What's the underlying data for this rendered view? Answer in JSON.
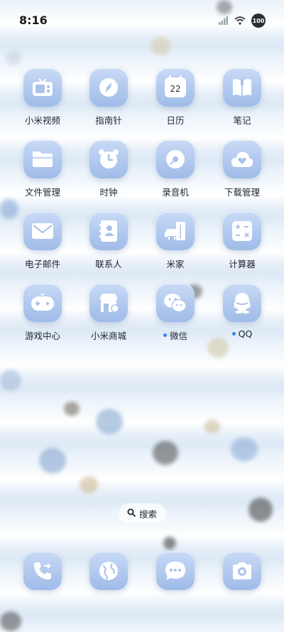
{
  "status_bar": {
    "time": "8:16",
    "battery": "100"
  },
  "apps": [
    {
      "id": "mi-video",
      "label": "小米视频",
      "icon": "tv-icon"
    },
    {
      "id": "compass",
      "label": "指南针",
      "icon": "compass-icon"
    },
    {
      "id": "calendar",
      "label": "日历",
      "icon": "calendar-icon",
      "day": "22"
    },
    {
      "id": "notes",
      "label": "笔记",
      "icon": "notebook-icon"
    },
    {
      "id": "file-manager",
      "label": "文件管理",
      "icon": "folder-icon"
    },
    {
      "id": "clock",
      "label": "时钟",
      "icon": "alarm-clock-icon"
    },
    {
      "id": "recorder",
      "label": "录音机",
      "icon": "record-disc-icon"
    },
    {
      "id": "downloads",
      "label": "下载管理",
      "icon": "cloud-heart-icon"
    },
    {
      "id": "email",
      "label": "电子邮件",
      "icon": "envelope-icon"
    },
    {
      "id": "contacts",
      "label": "联系人",
      "icon": "contacts-book-icon"
    },
    {
      "id": "mi-home",
      "label": "米家",
      "icon": "sofa-home-icon"
    },
    {
      "id": "calculator",
      "label": "计算器",
      "icon": "calculator-icon"
    },
    {
      "id": "game-center",
      "label": "游戏中心",
      "icon": "gamepad-icon"
    },
    {
      "id": "mi-store",
      "label": "小米商城",
      "icon": "store-icon"
    },
    {
      "id": "wechat",
      "label": "微信",
      "icon": "wechat-icon",
      "badge_dot": true
    },
    {
      "id": "qq",
      "label": "QQ",
      "icon": "qq-penguin-icon",
      "badge_dot": true
    }
  ],
  "search": {
    "label": "搜索"
  },
  "dock": [
    {
      "id": "phone",
      "icon": "phone-icon"
    },
    {
      "id": "browser",
      "icon": "globe-icon"
    },
    {
      "id": "messages",
      "icon": "message-bubble-icon"
    },
    {
      "id": "camera",
      "icon": "camera-icon"
    }
  ],
  "colors": {
    "icon_gradient_top": "#c8daf6",
    "icon_gradient_bottom": "#9fbbe8",
    "notification_dot": "#3b82e8"
  }
}
